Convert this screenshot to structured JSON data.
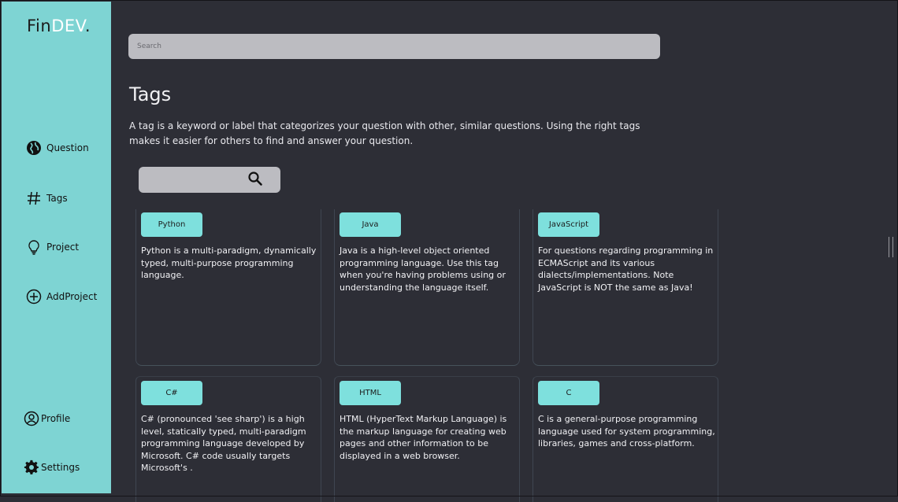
{
  "sidebar": {
    "logo_main": "Fin",
    "logo_highlight": "DEV",
    "logo_dot": ".",
    "nav": [
      {
        "label": "Question",
        "icon": "globe-icon"
      },
      {
        "label": "Tags",
        "icon": "hash-icon"
      },
      {
        "label": "Project",
        "icon": "lightbulb-icon"
      },
      {
        "label": "AddProject",
        "icon": "plus-circle-icon"
      },
      {
        "label": "Profile",
        "icon": "user-circle-icon"
      },
      {
        "label": "Settings",
        "icon": "gear-icon"
      }
    ]
  },
  "main": {
    "search_placeholder": "Search",
    "title": "Tags",
    "description": "A tag is a keyword or label that categorizes your question with other, similar questions. Using the right tags makes it easier for others to find and answer your question.",
    "tag_search_icon": "search-icon",
    "tags": [
      {
        "name": "Python",
        "description": "Python is a multi-paradigm, dynamically typed, multi-purpose programming language."
      },
      {
        "name": "Java",
        "description": "Java is a high-level object oriented programming language. Use this tag when you're having problems using or understanding the language itself."
      },
      {
        "name": "JavaScript",
        "description": "For questions regarding programming in ECMAScript and its various dialects/implementations. Note JavaScript is NOT the same as Java!"
      },
      {
        "name": "C#",
        "description": "C# (pronounced 'see sharp') is a high level, statically typed, multi-paradigm programming language developed by Microsoft. C# code usually targets Microsoft's ."
      },
      {
        "name": "HTML",
        "description": "HTML (HyperText Markup Language) is the markup language for creating web pages and other information to be displayed in a web browser."
      },
      {
        "name": "C",
        "description": "C is a general-purpose programming language used for system programming, libraries, games and cross-platform."
      }
    ]
  },
  "colors": {
    "sidebar_bg": "#7ed4d3",
    "page_bg": "#2d2e36",
    "badge_bg": "#7ee0dd",
    "search_bg": "#bcbcc1"
  }
}
